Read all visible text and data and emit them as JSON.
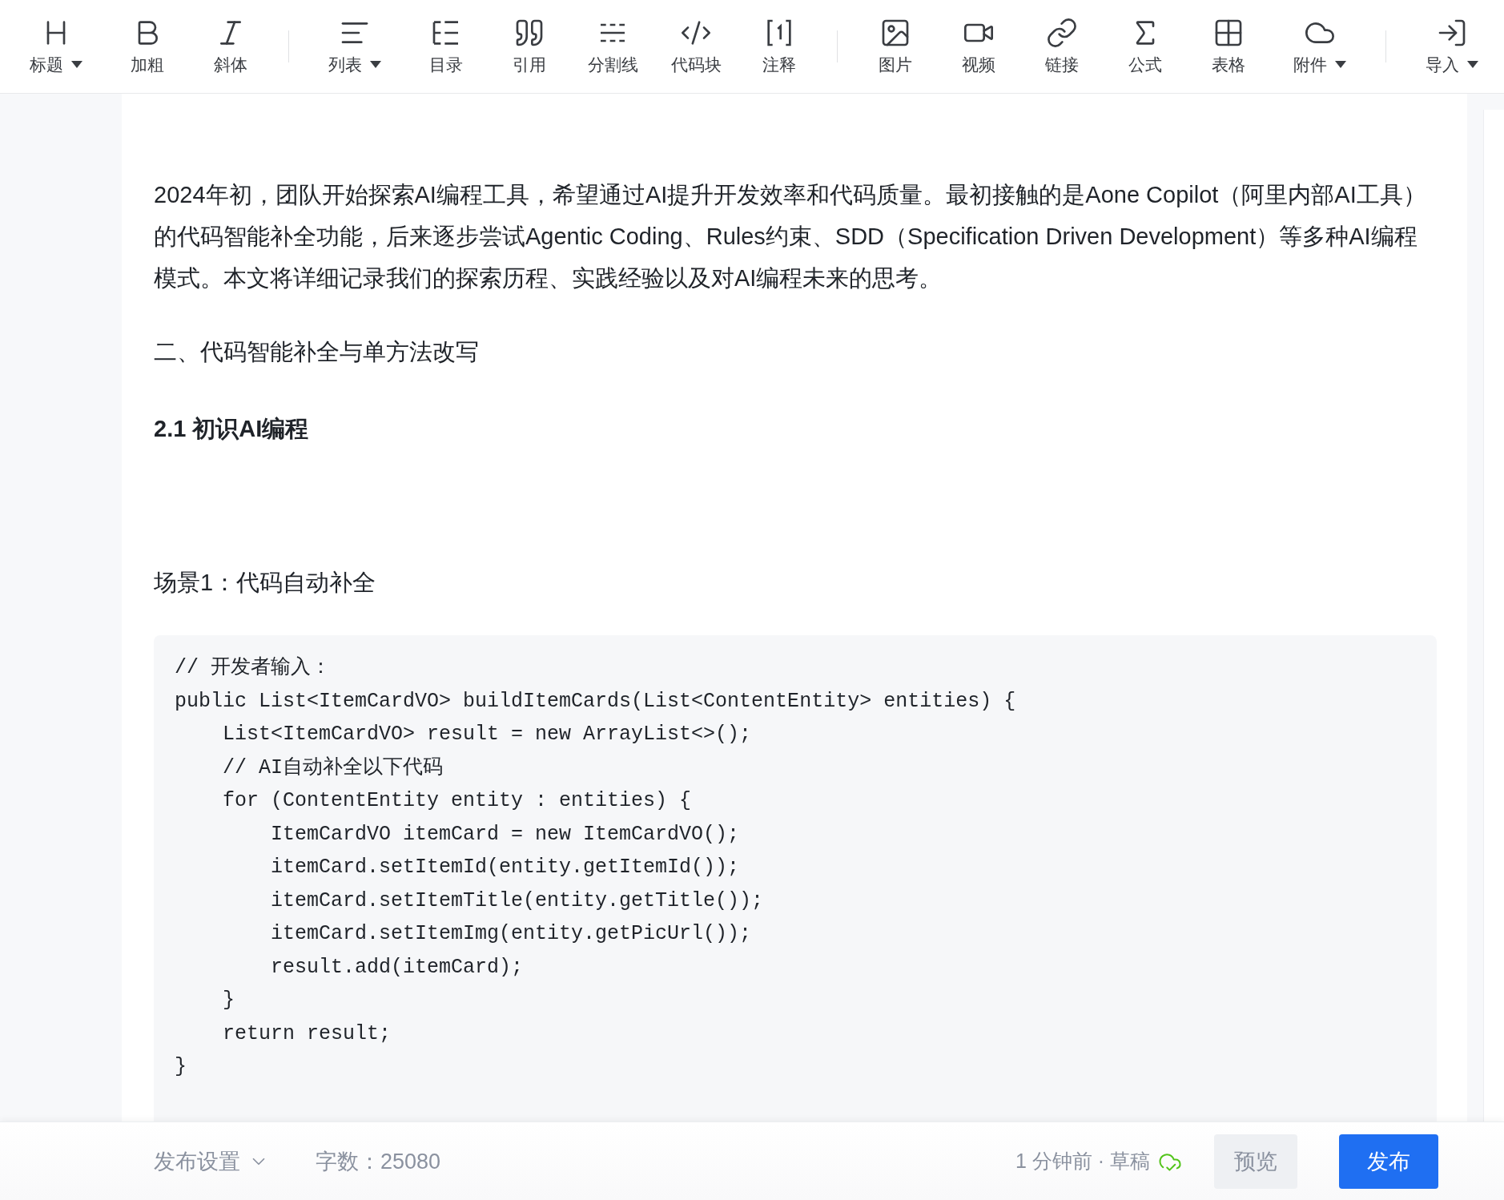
{
  "toolbar": {
    "groups": [
      [
        {
          "label": "标题",
          "dropdown": true
        },
        {
          "label": "加粗",
          "dropdown": false
        },
        {
          "label": "斜体",
          "dropdown": false
        }
      ],
      [
        {
          "label": "列表",
          "dropdown": true
        },
        {
          "label": "目录",
          "dropdown": false
        },
        {
          "label": "引用",
          "dropdown": false
        },
        {
          "label": "分割线",
          "dropdown": false
        },
        {
          "label": "代码块",
          "dropdown": false
        },
        {
          "label": "注释",
          "dropdown": false
        }
      ],
      [
        {
          "label": "图片",
          "dropdown": false
        },
        {
          "label": "视频",
          "dropdown": false
        },
        {
          "label": "链接",
          "dropdown": false
        },
        {
          "label": "公式",
          "dropdown": false
        },
        {
          "label": "表格",
          "dropdown": false
        },
        {
          "label": "附件",
          "dropdown": true
        }
      ],
      [
        {
          "label": "导入",
          "dropdown": true
        }
      ]
    ]
  },
  "document": {
    "blocks": [
      {
        "kind": "paragraph",
        "text": "2024年初，团队开始探索AI编程工具，希望通过AI提升开发效率和代码质量。最初接触的是Aone Copilot（阿里内部AI工具）的代码智能补全功能，后来逐步尝试Agentic Coding、Rules约束、SDD（Specification Driven Development）等多种AI编程模式。本文将详细记录我们的探索历程、实践经验以及对AI编程未来的思考。"
      },
      {
        "kind": "heading",
        "text": "二、代码智能补全与单方法改写"
      },
      {
        "kind": "subheading",
        "text": "2.1 初识AI编程"
      },
      {
        "kind": "spacer"
      },
      {
        "kind": "paragraph",
        "text": "场景1：代码自动补全"
      },
      {
        "kind": "code",
        "lines": [
          "// 开发者输入：",
          "public List<ItemCardVO> buildItemCards(List<ContentEntity> entities) {",
          "    List<ItemCardVO> result = new ArrayList<>();",
          "    // AI自动补全以下代码",
          "    for (ContentEntity entity : entities) {",
          "        ItemCardVO itemCard = new ItemCardVO();",
          "        itemCard.setItemId(entity.getItemId());",
          "        itemCard.setItemTitle(entity.getTitle());",
          "        itemCard.setItemImg(entity.getPicUrl());",
          "        result.add(itemCard);",
          "    }",
          "    return result;",
          "}"
        ]
      }
    ]
  },
  "footer": {
    "settings": "发布设置",
    "word_count": "字数：25080",
    "save_status": "1 分钟前 · 草稿",
    "preview": "预览",
    "publish": "发布"
  }
}
